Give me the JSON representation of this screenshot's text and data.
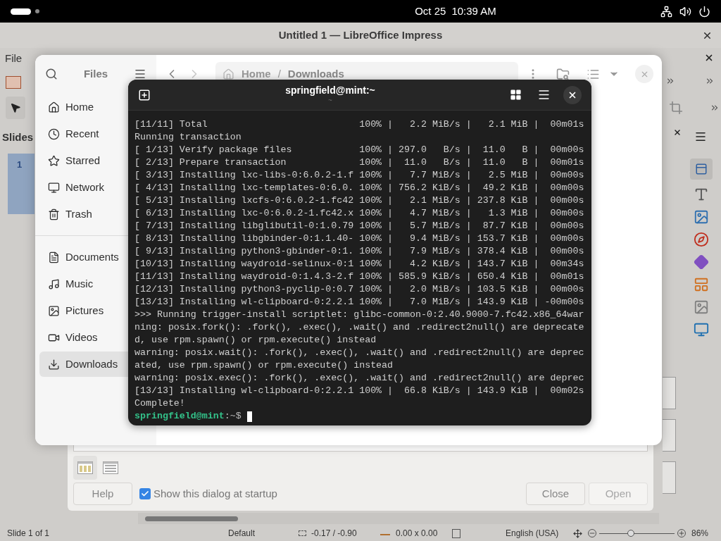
{
  "top_bar": {
    "date": "Oct 25",
    "time": "10:39 AM"
  },
  "impress": {
    "title": "Untitled 1 — LibreOffice Impress",
    "menu": [
      "File"
    ],
    "slides_label": "Slides",
    "slides": [
      {
        "number": "1",
        "selected": true
      }
    ],
    "status_bar": {
      "slide": "Slide 1 of 1",
      "layout": "Default",
      "position": "-0.17 / -0.90",
      "size": "0.00 x 0.00",
      "language": "English (USA)",
      "zoom": {
        "level": 0.42,
        "reading": "86%"
      }
    }
  },
  "template_dialog": {
    "views": [
      {
        "kind": "grid",
        "selected": true
      },
      {
        "kind": "list",
        "selected": false
      }
    ],
    "help": "Help",
    "show_at_startup": {
      "label": "Show this dialog at startup",
      "checked": true
    },
    "buttons": [
      {
        "label": "Close",
        "disabled": false
      },
      {
        "label": "Open",
        "disabled": true
      }
    ]
  },
  "files": {
    "title": "Files",
    "path": [
      "Home",
      "Downloads"
    ],
    "path_separator": "/",
    "places": [
      {
        "kind": "home",
        "label": "Home",
        "selected": false
      },
      {
        "kind": "recent",
        "label": "Recent",
        "selected": false
      },
      {
        "kind": "starred",
        "label": "Starred",
        "selected": false
      },
      {
        "kind": "network",
        "label": "Network",
        "selected": false
      },
      {
        "kind": "trash",
        "label": "Trash",
        "selected": false
      }
    ],
    "bookmarks": [
      {
        "kind": "documents",
        "label": "Documents",
        "selected": false
      },
      {
        "kind": "music",
        "label": "Music",
        "selected": false
      },
      {
        "kind": "pictures",
        "label": "Pictures",
        "selected": false
      },
      {
        "kind": "videos",
        "label": "Videos",
        "selected": false
      },
      {
        "kind": "downloads",
        "label": "Downloads",
        "selected": true
      }
    ]
  },
  "terminal": {
    "title": "springfield@mint:~",
    "subtitle": "~",
    "lines": [
      "[11/11] Total                           100% |   2.2 MiB/s |   2.1 MiB |  00m01s",
      "Running transaction",
      "[ 1/13] Verify package files            100% | 297.0   B/s |  11.0   B |  00m00s",
      "[ 2/13] Prepare transaction             100% |  11.0   B/s |  11.0   B |  00m01s",
      "[ 3/13] Installing lxc-libs-0:6.0.2-1.f 100% |   7.7 MiB/s |   2.5 MiB |  00m00s",
      "[ 4/13] Installing lxc-templates-0:6.0. 100% | 756.2 KiB/s |  49.2 KiB |  00m00s",
      "[ 5/13] Installing lxcfs-0:6.0.2-1.fc42 100% |   2.1 MiB/s | 237.8 KiB |  00m00s",
      "[ 6/13] Installing lxc-0:6.0.2-1.fc42.x 100% |   4.7 MiB/s |   1.3 MiB |  00m00s",
      "[ 7/13] Installing libglibutil-0:1.0.79 100% |   5.7 MiB/s |  87.7 KiB |  00m00s",
      "[ 8/13] Installing libgbinder-0:1.1.40- 100% |   9.4 MiB/s | 153.7 KiB |  00m00s",
      "[ 9/13] Installing python3-gbinder-0:1. 100% |   7.9 MiB/s | 378.4 KiB |  00m00s",
      "[10/13] Installing waydroid-selinux-0:1 100% |   4.2 KiB/s | 143.7 KiB |  00m34s",
      "[11/13] Installing waydroid-0:1.4.3-2.f 100% | 585.9 KiB/s | 650.4 KiB |  00m01s",
      "[12/13] Installing python3-pyclip-0:0.7 100% |   2.0 MiB/s | 103.5 KiB |  00m00s",
      "[13/13] Installing wl-clipboard-0:2.2.1 100% |   7.0 MiB/s | 143.9 KiB | -00m00s",
      ">>> Running trigger-install scriptlet: glibc-common-0:2.40.9000-7.fc42.x86_64war",
      "ning: posix.fork(): .fork(), .exec(), .wait() and .redirect2null() are deprecate",
      "d, use rpm.spawn() or rpm.execute() instead",
      "warning: posix.wait(): .fork(), .exec(), .wait() and .redirect2null() are deprec",
      "ated, use rpm.spawn() or rpm.execute() instead",
      "warning: posix.exec(): .fork(), .exec(), .wait() and .redirect2null() are deprec",
      "[13/13] Installing wl-clipboard-0:2.2.1 100% |  66.8 KiB/s | 143.9 KiB |  00m02s",
      "Complete!"
    ],
    "prompt": {
      "user": "springfield@mint",
      "path": ":~$"
    }
  }
}
